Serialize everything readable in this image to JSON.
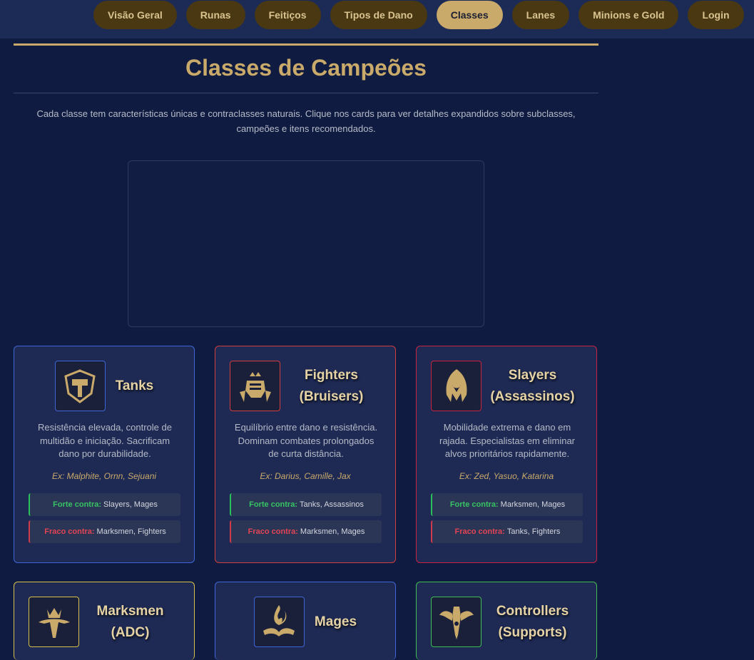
{
  "nav": {
    "items": [
      {
        "label": "Visão Geral",
        "active": false
      },
      {
        "label": "Runas",
        "active": false
      },
      {
        "label": "Feitiços",
        "active": false
      },
      {
        "label": "Tipos de Dano",
        "active": false
      },
      {
        "label": "Classes",
        "active": true
      },
      {
        "label": "Lanes",
        "active": false
      },
      {
        "label": "Minions e Gold",
        "active": false
      },
      {
        "label": "Login",
        "active": false
      }
    ]
  },
  "page": {
    "title": "Classes de Campeões",
    "intro_line1": "Cada classe tem características únicas e contraclasses naturais. Clique nos cards para ver detalhes expandidos sobre subclasses,",
    "intro_line2": "campeões e itens recomendados."
  },
  "labels": {
    "strong": "Forte contra:",
    "weak": "Fraco contra:"
  },
  "colors": {
    "accent_gold": "#c9aa6a",
    "tanks_border": "#3f66d6",
    "fighters_border": "#d23d3d",
    "slayers_border": "#c8243f",
    "marksmen_border": "#d6c24a",
    "mages_border": "#3f66d6",
    "controllers_border": "#3fbf52"
  },
  "cards": [
    {
      "name_line1": "Tanks",
      "name_line2": "",
      "icon": "shield-hammer-icon",
      "desc_line1": "Resistência elevada, controle de",
      "desc_line2": "multidão e iniciação. Sacrificam",
      "desc_line3": "dano por durabilidade.",
      "example": "Ex: Malphite, Ornn, Sejuani",
      "strong": "Slayers, Mages",
      "weak": "Marksmen, Fighters"
    },
    {
      "name_line1": "Fighters",
      "name_line2": "(Bruisers)",
      "icon": "fist-icon",
      "desc_line1": "Equilíbrio entre dano e resistência.",
      "desc_line2": "Dominam combates prolongados",
      "desc_line3": "de curta distância.",
      "example": "Ex: Darius, Camille, Jax",
      "strong": "Tanks, Assassinos",
      "weak": "Marksmen, Mages"
    },
    {
      "name_line1": "Slayers",
      "name_line2": "(Assassinos)",
      "icon": "hooded-assassin-icon",
      "desc_line1": "Mobilidade extrema e dano em",
      "desc_line2": "rajada. Especialistas em eliminar",
      "desc_line3": "alvos prioritários rapidamente.",
      "example": "Ex: Zed, Yasuo, Katarina",
      "strong": "Marksmen, Mages",
      "weak": "Tanks, Fighters"
    },
    {
      "name_line1": "Marksmen",
      "name_line2": "(ADC)",
      "icon": "crowned-crossbow-icon"
    },
    {
      "name_line1": "Mages",
      "name_line2": "",
      "icon": "flame-book-icon"
    },
    {
      "name_line1": "Controllers",
      "name_line2": "(Supports)",
      "icon": "winged-staff-icon"
    }
  ]
}
